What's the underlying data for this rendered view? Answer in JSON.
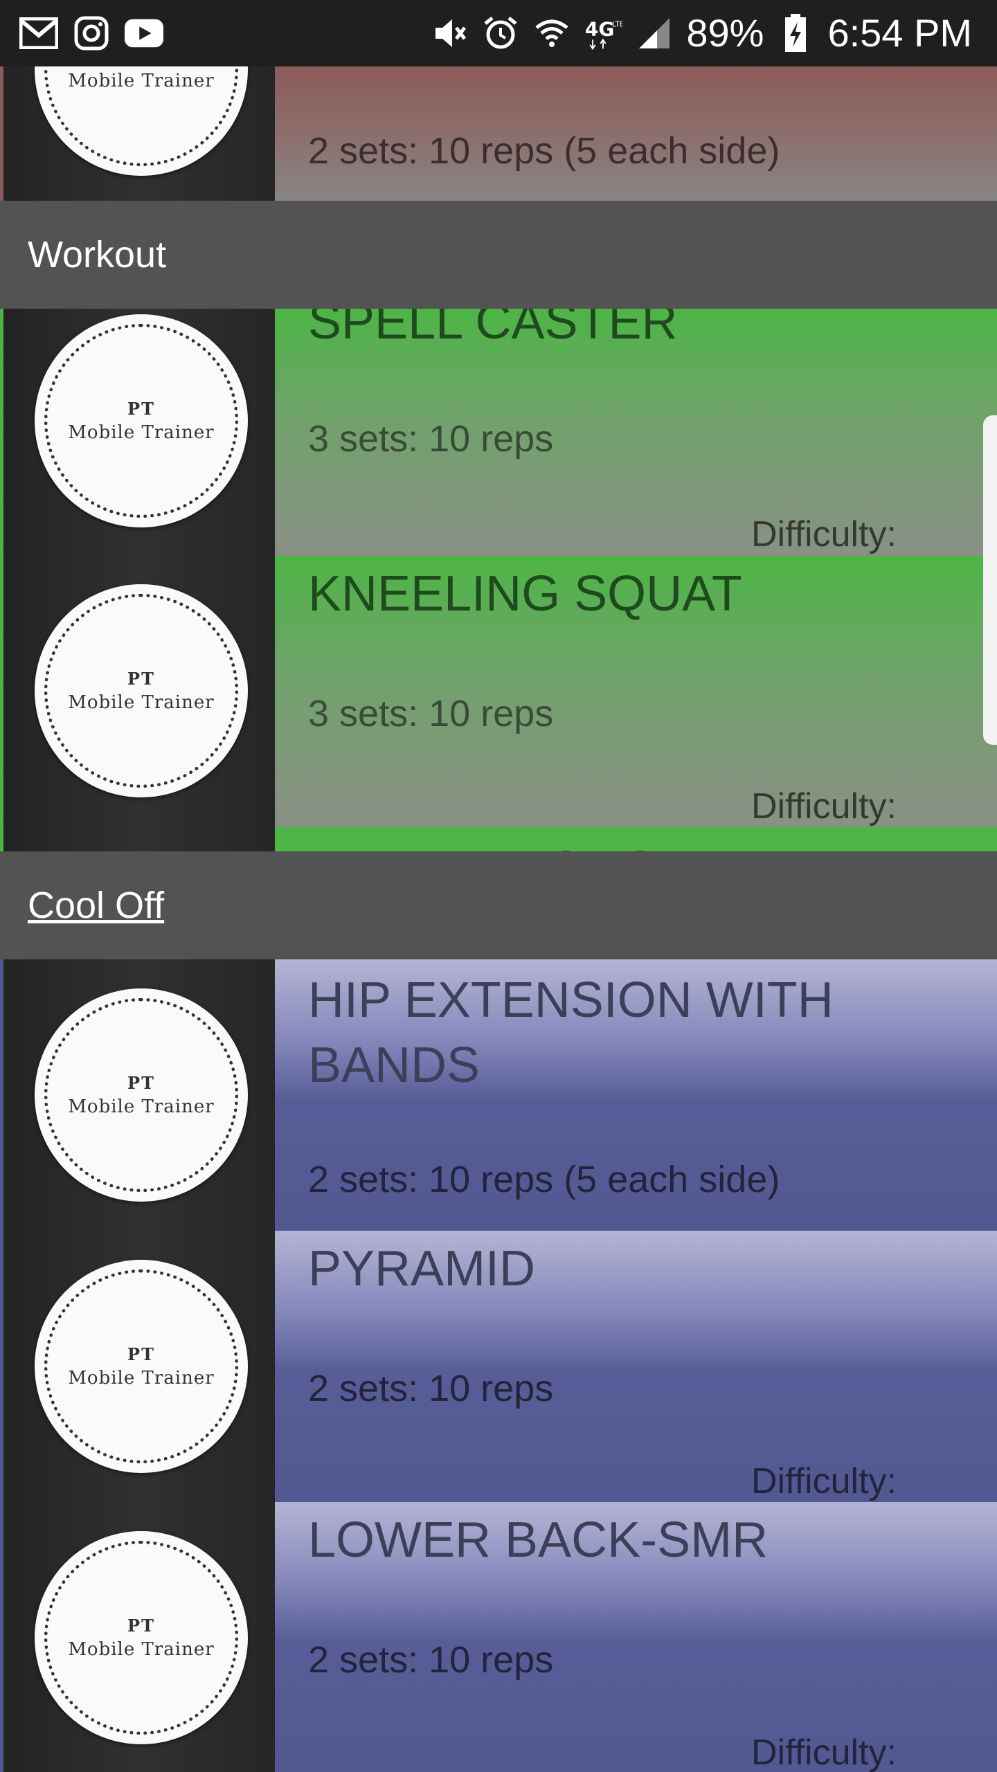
{
  "status_bar": {
    "left_icons": [
      "gmail-icon",
      "instagram-icon",
      "youtube-icon"
    ],
    "right_icons": [
      "mute-icon",
      "alarm-icon",
      "wifi-icon",
      "4g-lte-icon",
      "signal-icon",
      "battery-charging-icon"
    ],
    "battery": "89%",
    "time": "6:54 PM"
  },
  "logo": {
    "line1": "PT",
    "line2": "Mobile Trainer"
  },
  "warmup_partial": {
    "sets": "2 sets: 10 reps (5 each side)"
  },
  "sections": {
    "workout": "Workout",
    "cooloff": "Cool Off"
  },
  "workout_items": [
    {
      "title": "SPELL CASTER",
      "sets": "3 sets: 10 reps",
      "difficulty": "Difficulty:"
    },
    {
      "title": "KNEELING SQUAT",
      "sets": "3 sets: 10 reps",
      "difficulty": "Difficulty:"
    },
    {
      "title": "PULL THROUGH"
    }
  ],
  "cooloff_items": [
    {
      "title": "HIP EXTENSION WITH BANDS",
      "sets": "2 sets: 10 reps (5 each side)"
    },
    {
      "title": "PYRAMID",
      "sets": "2 sets: 10 reps",
      "difficulty": "Difficulty:"
    },
    {
      "title": "LOWER BACK-SMR",
      "sets": "2 sets: 10 reps",
      "difficulty": "Difficulty:"
    }
  ],
  "colors": {
    "workout_accent": "#4db545",
    "cooloff_accent": "#525892",
    "warmup_accent": "#8c5a5a",
    "section_header_bg": "#535353"
  }
}
